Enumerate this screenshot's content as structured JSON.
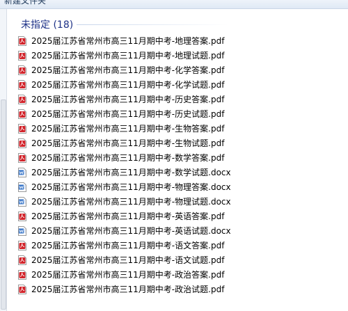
{
  "toolbar": {
    "new_folder_label": "新建文件夹"
  },
  "group": {
    "title": "未指定 (18)"
  },
  "colors": {
    "pdf_icon": "#d2232a",
    "docx_icon": "#2b6cc4",
    "group_title": "#1e3287"
  },
  "files": [
    {
      "name": "2025届江苏省常州市高三11月期中考-地理答案.pdf",
      "icon": "pdf-icon"
    },
    {
      "name": "2025届江苏省常州市高三11月期中考-地理试题.pdf",
      "icon": "pdf-icon"
    },
    {
      "name": "2025届江苏省常州市高三11月期中考-化学答案.pdf",
      "icon": "pdf-icon"
    },
    {
      "name": "2025届江苏省常州市高三11月期中考-化学试题.pdf",
      "icon": "pdf-icon"
    },
    {
      "name": "2025届江苏省常州市高三11月期中考-历史答案.pdf",
      "icon": "pdf-icon"
    },
    {
      "name": "2025届江苏省常州市高三11月期中考-历史试题.pdf",
      "icon": "pdf-icon"
    },
    {
      "name": "2025届江苏省常州市高三11月期中考-生物答案.pdf",
      "icon": "pdf-icon"
    },
    {
      "name": "2025届江苏省常州市高三11月期中考-生物试题.pdf",
      "icon": "pdf-icon"
    },
    {
      "name": "2025届江苏省常州市高三11月期中考-数学答案.pdf",
      "icon": "pdf-icon"
    },
    {
      "name": "2025届江苏省常州市高三11月期中考-数学试题.docx",
      "icon": "word-icon"
    },
    {
      "name": "2025届江苏省常州市高三11月期中考-物理答案.docx",
      "icon": "word-icon"
    },
    {
      "name": "2025届江苏省常州市高三11月期中考-物理试题.docx",
      "icon": "word-icon"
    },
    {
      "name": "2025届江苏省常州市高三11月期中考-英语答案.pdf",
      "icon": "pdf-icon"
    },
    {
      "name": "2025届江苏省常州市高三11月期中考-英语试题.docx",
      "icon": "word-icon"
    },
    {
      "name": "2025届江苏省常州市高三11月期中考-语文答案.pdf",
      "icon": "pdf-icon"
    },
    {
      "name": "2025届江苏省常州市高三11月期中考-语文试题.pdf",
      "icon": "pdf-icon"
    },
    {
      "name": "2025届江苏省常州市高三11月期中考-政治答案.pdf",
      "icon": "pdf-icon"
    },
    {
      "name": "2025届江苏省常州市高三11月期中考-政治试题.pdf",
      "icon": "pdf-icon"
    }
  ]
}
